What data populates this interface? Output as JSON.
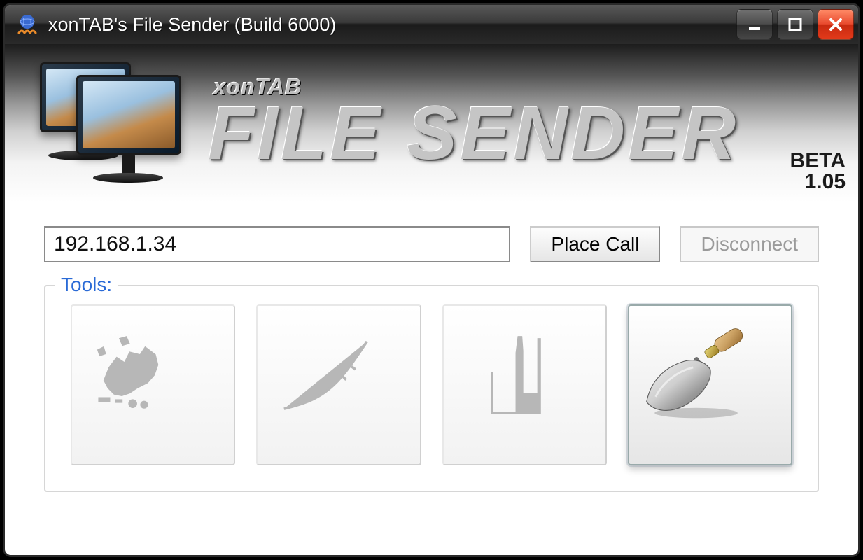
{
  "window": {
    "title": "xonTAB's File Sender (Build 6000)"
  },
  "banner": {
    "subtitle": "xonTAB",
    "title": "FILE SENDER",
    "beta_line1": "BETA",
    "beta_line2": "1.05"
  },
  "call": {
    "ip_value": "192.168.1.34",
    "place_label": "Place Call",
    "disconnect_label": "Disconnect"
  },
  "tools": {
    "legend": "Tools:",
    "items": [
      {
        "name": "tool-1"
      },
      {
        "name": "tool-2"
      },
      {
        "name": "tool-3"
      },
      {
        "name": "tool-trowel",
        "selected": true
      }
    ]
  }
}
